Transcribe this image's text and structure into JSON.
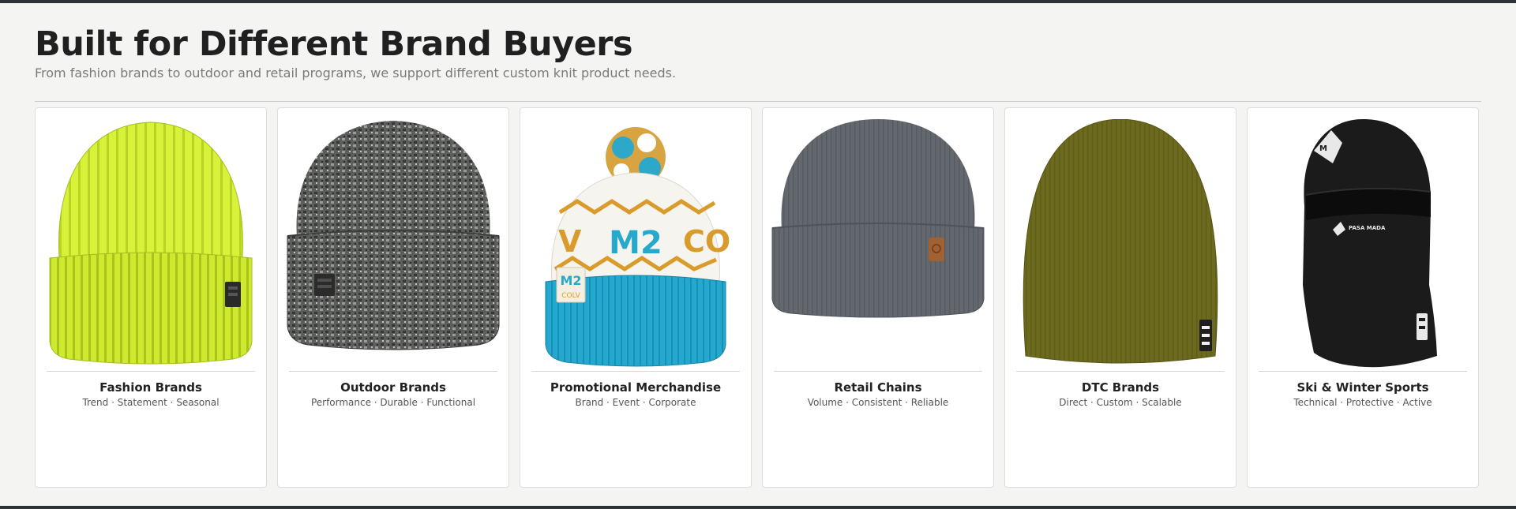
{
  "header": {
    "title": "Built for Different Brand Buyers",
    "subtitle": "From fashion brands to outdoor and retail programs, we support different custom knit product needs."
  },
  "cards": [
    {
      "title": "Fashion Brands",
      "tags": "Trend · Statement · Seasonal",
      "image": "neon-yellow-ribbed-beanie",
      "color": "#d8f23a"
    },
    {
      "title": "Outdoor Brands",
      "tags": "Performance · Durable · Functional",
      "image": "grey-marled-chunky-beanie",
      "color": "#5b5d5a"
    },
    {
      "title": "Promotional Merchandise",
      "tags": "Brand · Event · Corporate",
      "image": "jacquard-pom-pom-beanie",
      "color": "#23a9cf"
    },
    {
      "title": "Retail Chains",
      "tags": "Volume · Consistent · Reliable",
      "image": "slate-cuffed-beanie",
      "color": "#62666d"
    },
    {
      "title": "DTC Brands",
      "tags": "Direct · Custom · Scalable",
      "image": "olive-slouch-beanie",
      "color": "#6c6a1e"
    },
    {
      "title": "Ski & Winter Sports",
      "tags": "Technical · Protective · Active",
      "image": "black-balaclava",
      "color": "#1a1a1a"
    }
  ],
  "logo_text": {
    "badge": "M2",
    "badge_sub": "COLV",
    "balaclava": "PASA MADA"
  }
}
